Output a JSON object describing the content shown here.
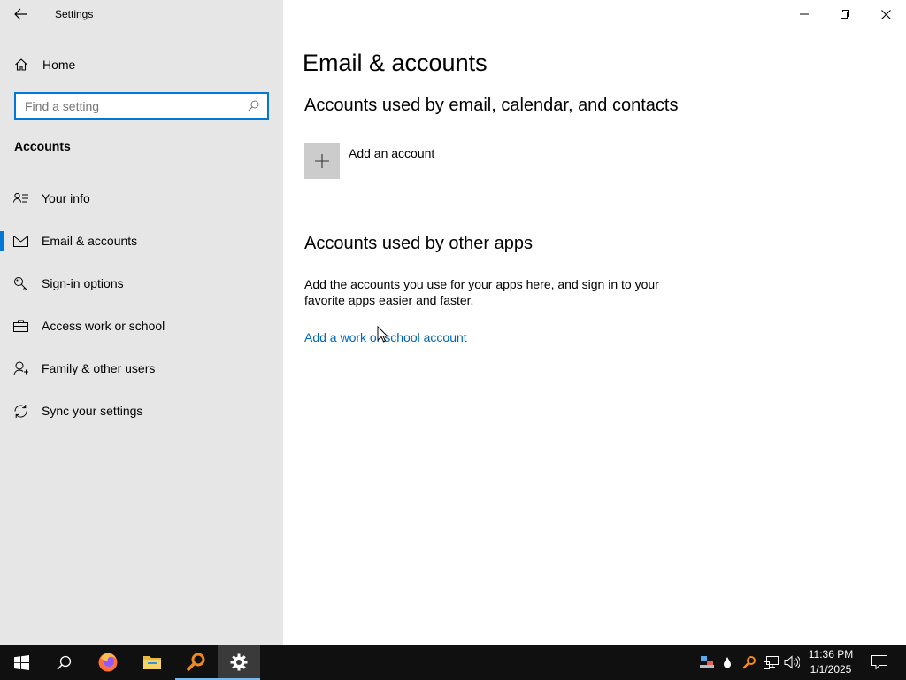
{
  "window": {
    "title": "Settings",
    "controls": [
      "minimize",
      "restore",
      "close"
    ]
  },
  "sidebar": {
    "home_label": "Home",
    "search": {
      "placeholder": "Find a setting",
      "value": ""
    },
    "section_title": "Accounts",
    "items": [
      {
        "label": "Your info",
        "icon": "person-card-icon",
        "selected": false
      },
      {
        "label": "Email & accounts",
        "icon": "mail-icon",
        "selected": true
      },
      {
        "label": "Sign-in options",
        "icon": "key-icon",
        "selected": false
      },
      {
        "label": "Access work or school",
        "icon": "briefcase-icon",
        "selected": false
      },
      {
        "label": "Family & other users",
        "icon": "person-add-icon",
        "selected": false
      },
      {
        "label": "Sync your settings",
        "icon": "sync-icon",
        "selected": false
      }
    ]
  },
  "main": {
    "title": "Email & accounts",
    "section1_heading": "Accounts used by email, calendar, and contacts",
    "add_account_label": "Add an account",
    "section2_heading": "Accounts used by other apps",
    "section2_description": "Add the accounts you use for your apps here, and sign in to your favorite apps easier and faster.",
    "work_school_link": "Add a work or school account"
  },
  "taskbar": {
    "items": [
      "start-icon",
      "search-icon",
      "firefox-icon",
      "file-explorer-icon",
      "search-app-icon",
      "settings-icon"
    ],
    "active_item": "settings-icon",
    "tray_icons": [
      "network-adapter-icon",
      "droplet-icon",
      "magnifier-tray-icon",
      "network-icon",
      "volume-icon"
    ],
    "time": "11:36 PM",
    "date": "1/1/2025"
  },
  "colors": {
    "accent": "#0078d7",
    "link": "#0067b8",
    "sidebar_bg": "#e6e6e6",
    "taskbar_bg": "#101010"
  }
}
